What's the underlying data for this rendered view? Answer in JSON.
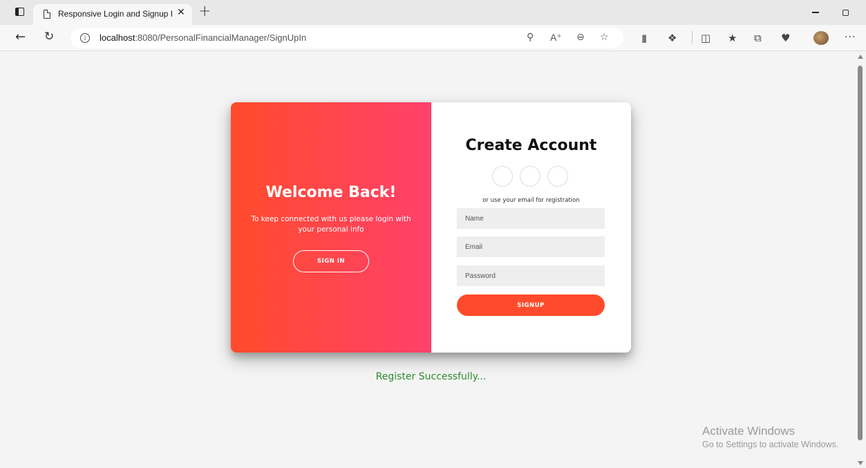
{
  "browser": {
    "tab_title": "Responsive Login and Signup Fo",
    "tab_close": "✕",
    "new_tab": "+",
    "url_host": "localhost",
    "url_rest": ":8080/PersonalFinancialManager/SignUpIn",
    "info_glyph": "i",
    "icons": [
      "tab-actions-icon",
      "page-icon",
      "back-icon",
      "refresh-icon",
      "info-icon",
      "key-icon",
      "read-aloud-icon",
      "zoom-out-icon",
      "favorite-star-icon",
      "shield-icon",
      "extensions-icon",
      "split-screen-icon",
      "favorites-icon",
      "collections-icon",
      "browser-essentials-icon",
      "profile-avatar",
      "more-icon"
    ]
  },
  "overlay": {
    "title": "Welcome Back!",
    "text": "To keep connected with us please login with your personal info",
    "signin_label": "SIGN IN"
  },
  "form": {
    "title": "Create Account",
    "hint": "or use your email for registration",
    "name_placeholder": "Name",
    "email_placeholder": "Email",
    "password_placeholder": "Password",
    "signup_label": "SIGNUP"
  },
  "status": {
    "message": "Register Successfully..."
  },
  "watermark": {
    "title": "Activate Windows",
    "subtitle": "Go to Settings to activate Windows."
  },
  "colors": {
    "gradient_start": "#ff4b2b",
    "gradient_end": "#ff416c",
    "success_text": "#2e8b2e"
  }
}
